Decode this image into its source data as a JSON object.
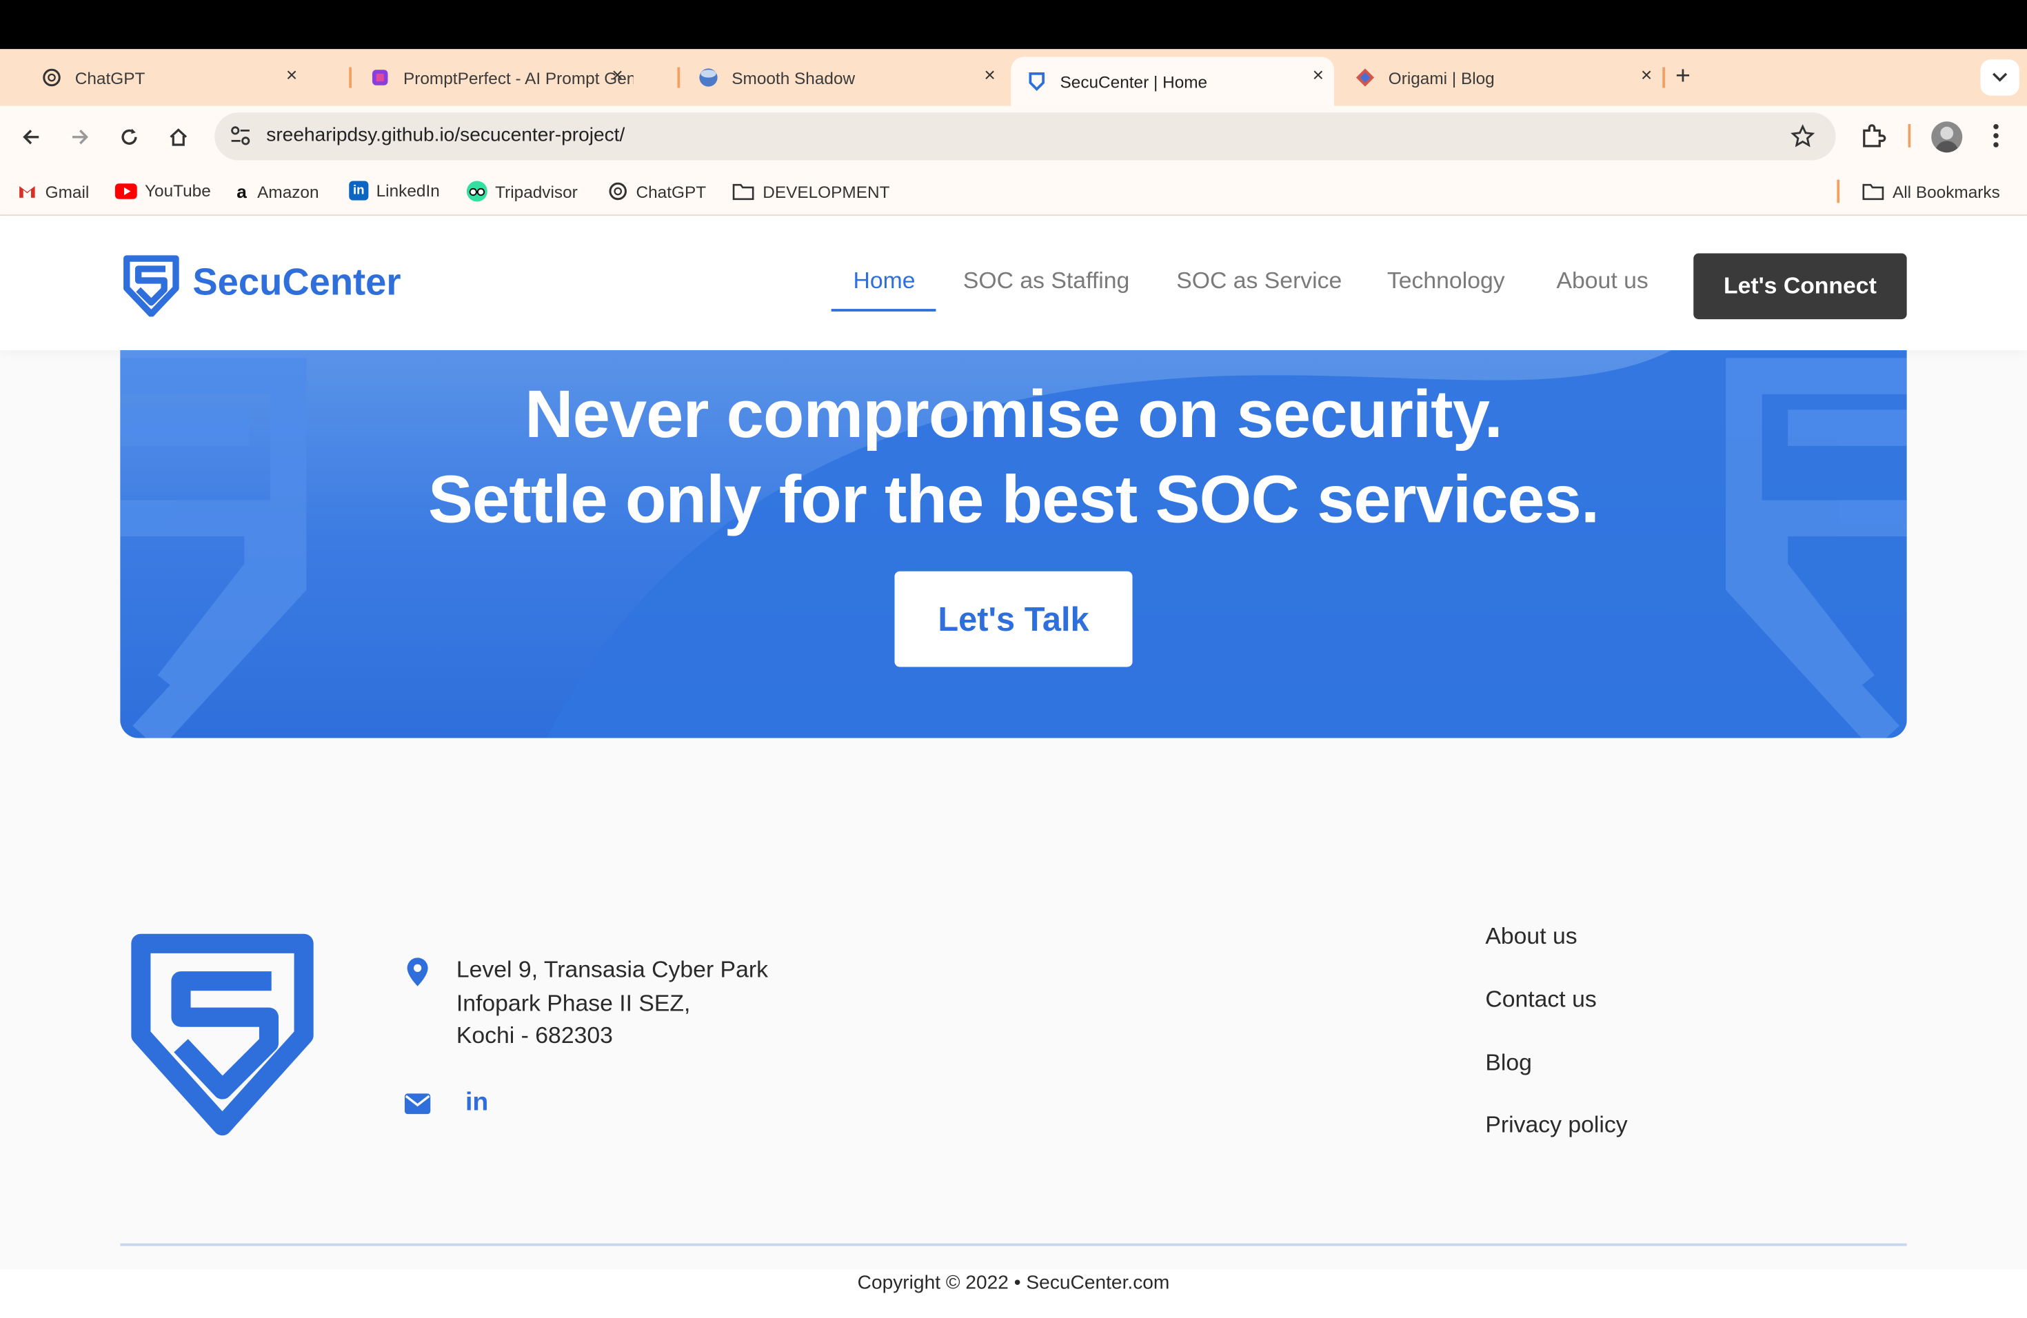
{
  "browser": {
    "tabs": [
      {
        "title": "ChatGPT",
        "icon": "chatgpt-icon"
      },
      {
        "title": "PromptPerfect - AI Prompt Generator",
        "icon": "promptperfect-icon"
      },
      {
        "title": "Smooth Shadow",
        "icon": "smooth-shadow-icon"
      },
      {
        "title": "SecuCenter | Home",
        "icon": "secucenter-icon",
        "active": true
      },
      {
        "title": "Origami | Blog",
        "icon": "origami-icon"
      }
    ],
    "new_tab": "+",
    "close_glyph": "×",
    "url": "sreeharipdsy.github.io/secucenter-project/",
    "bookmarks": [
      {
        "label": "Gmail",
        "icon": "gmail-icon"
      },
      {
        "label": "YouTube",
        "icon": "youtube-icon"
      },
      {
        "label": "Amazon",
        "icon": "amazon-icon"
      },
      {
        "label": "LinkedIn",
        "icon": "linkedin-icon"
      },
      {
        "label": "Tripadvisor",
        "icon": "tripadvisor-icon"
      },
      {
        "label": "ChatGPT",
        "icon": "chatgpt-icon"
      },
      {
        "label": "DEVELOPMENT",
        "icon": "folder-icon"
      }
    ],
    "all_bookmarks": "All Bookmarks"
  },
  "site": {
    "brand": "SecuCenter",
    "nav": [
      "Home",
      "SOC as Staffing",
      "SOC as Service",
      "Technology",
      "About us"
    ],
    "active_nav": "Home",
    "cta": "Let's Connect",
    "hero": {
      "line1": "Never compromise on security.",
      "line2": "Settle only for the best SOC services.",
      "button": "Let's Talk"
    },
    "footer": {
      "address": [
        "Level 9, Transasia Cyber Park",
        "Infopark Phase II SEZ,",
        "Kochi - 682303"
      ],
      "links": [
        "About us",
        "Contact us",
        "Blog",
        "Privacy policy"
      ],
      "copyright": "Copyright © 2022 • SecuCenter.com"
    }
  },
  "colors": {
    "brand_blue": "#2f6fdc",
    "hero_blue": "#2f73de",
    "dark_button": "#3a3a3a",
    "tabstrip": "#fde1c9"
  }
}
